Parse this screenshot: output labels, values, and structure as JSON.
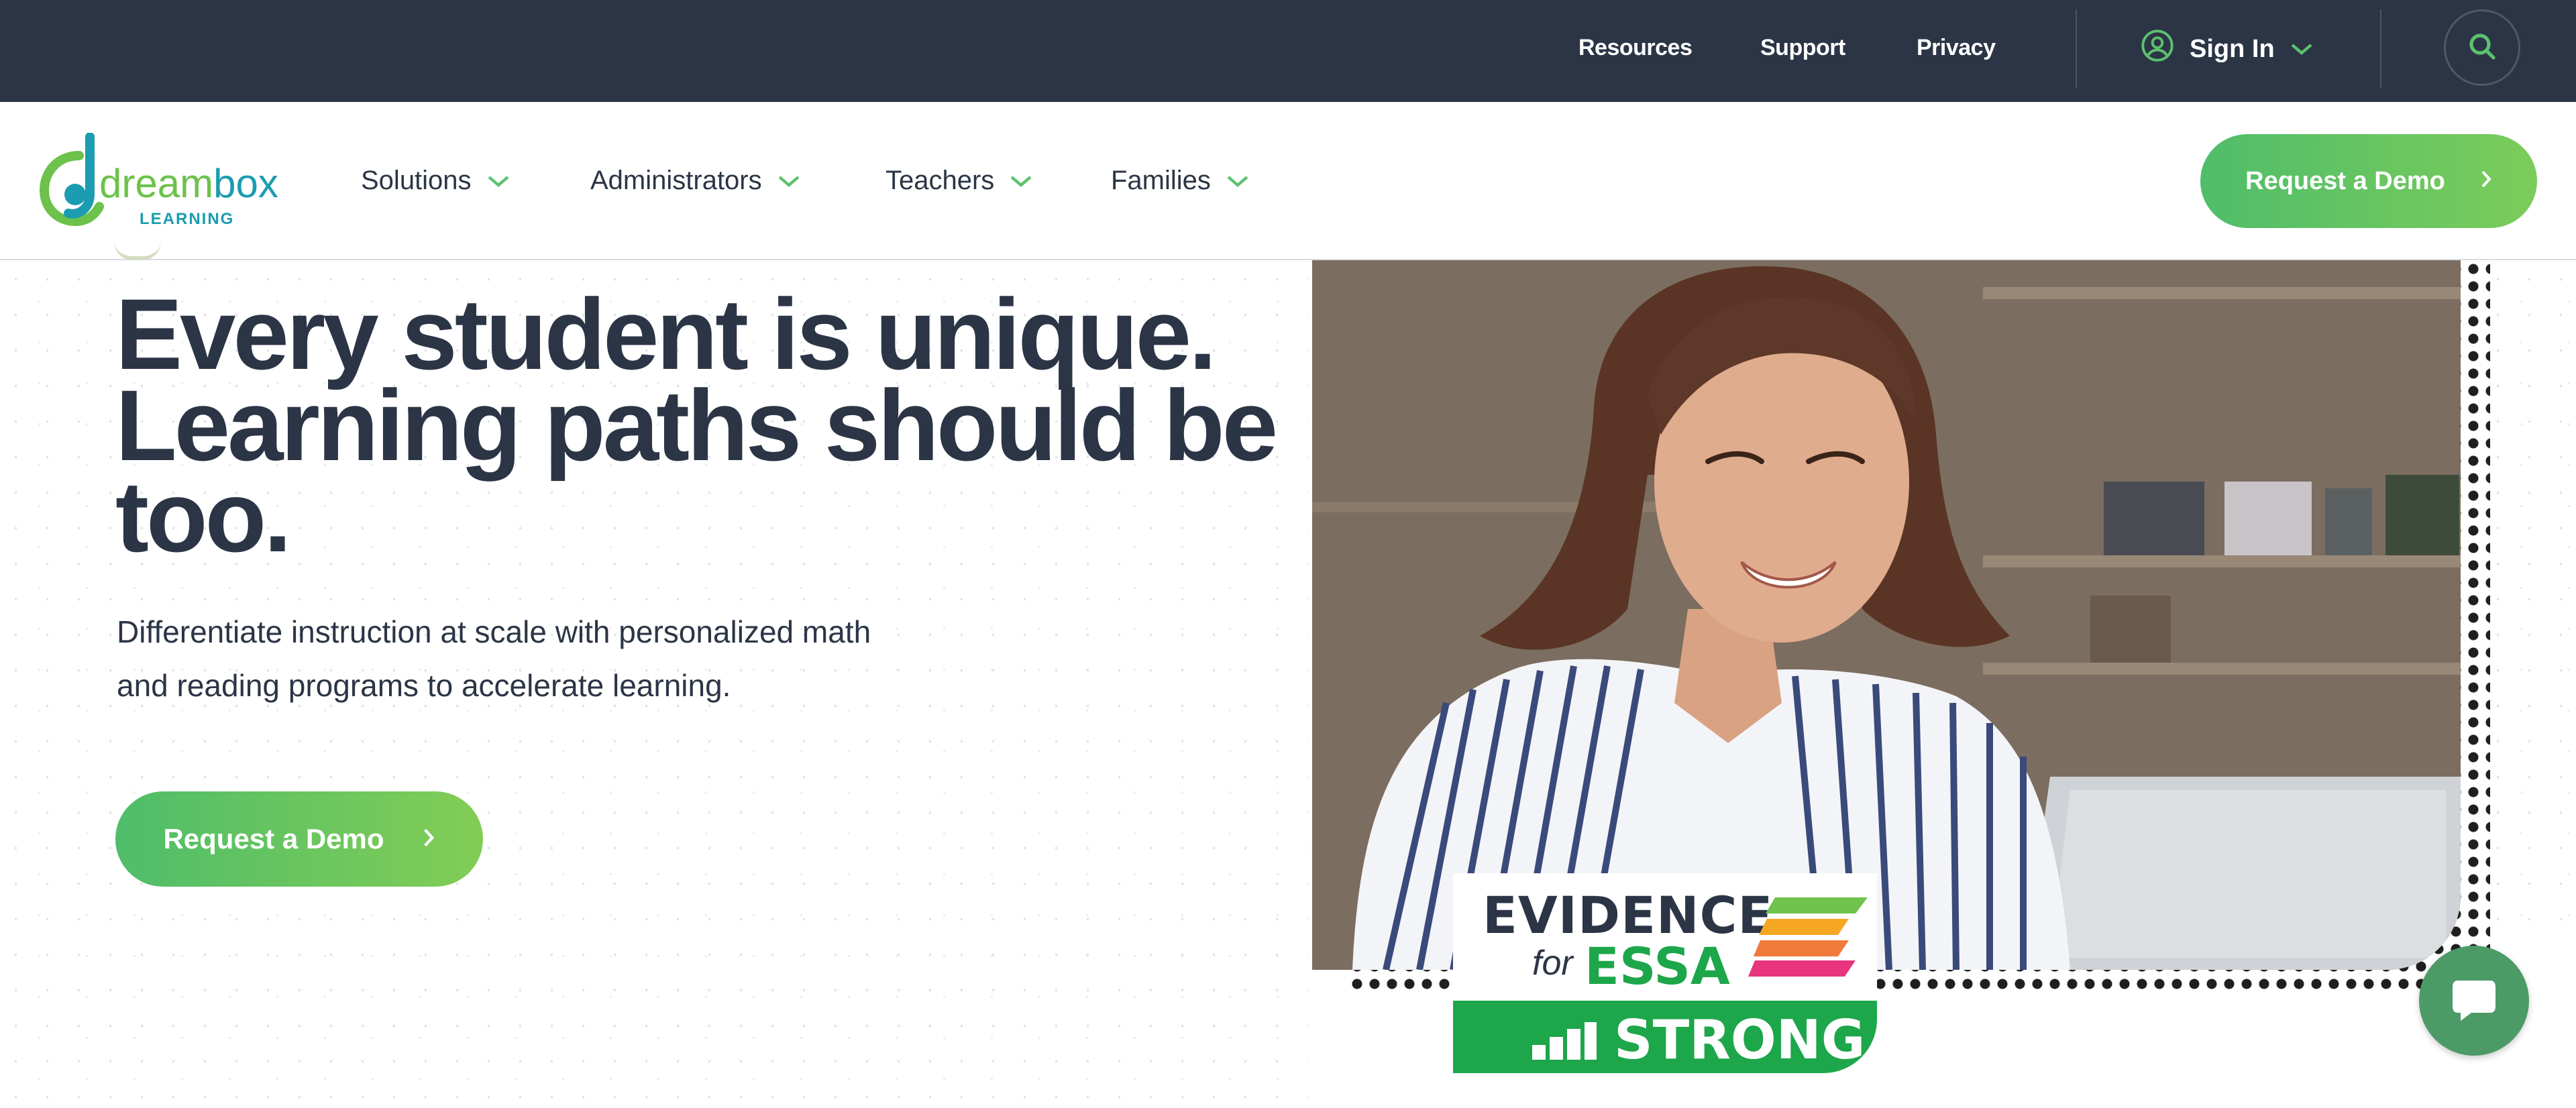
{
  "topbar": {
    "links": [
      "Resources",
      "Support",
      "Privacy"
    ],
    "signin_label": "Sign In"
  },
  "header": {
    "logo": {
      "brand": "dreambox",
      "sub": "LEARNING"
    },
    "nav": [
      "Solutions",
      "Administrators",
      "Teachers",
      "Families"
    ],
    "cta_label": "Request a Demo"
  },
  "hero": {
    "title": "Every student is unique. Learning paths should be too.",
    "subtitle_line1": "Differentiate instruction at scale with personalized math",
    "subtitle_line2": "and reading programs to accelerate learning.",
    "cta_label": "Request a Demo"
  },
  "badge": {
    "evidence": "EVIDENCE",
    "for": "for",
    "essa": "ESSA",
    "strong": "STRONG"
  },
  "colors": {
    "topbar_bg": "#2b3546",
    "brand_green": "#4fbd6a",
    "essa_green": "#1da64a",
    "text_dark": "#2b3546"
  },
  "icons": {
    "signin": "user-circle-icon",
    "search": "search-icon",
    "chevron": "chevron-down-icon",
    "cta_arrow": "chevron-right-icon",
    "chat": "chat-bubble-icon"
  }
}
